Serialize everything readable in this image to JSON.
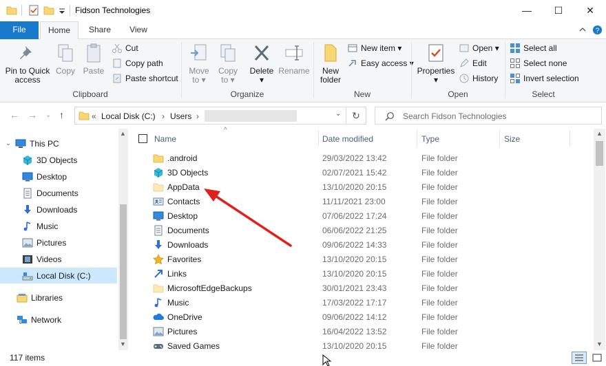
{
  "window": {
    "title": "Fidson Technologies",
    "minimize_glyph": "—",
    "maximize_glyph": "☐",
    "close_glyph": "✕"
  },
  "tabs": {
    "file": "File",
    "home": "Home",
    "share": "Share",
    "view": "View"
  },
  "ribbon": {
    "clipboard": {
      "label": "Clipboard",
      "pin_line1": "Pin to Quick",
      "pin_line2": "access",
      "copy": "Copy",
      "paste": "Paste",
      "cut": "Cut",
      "copy_path": "Copy path",
      "paste_shortcut": "Paste shortcut"
    },
    "organize": {
      "label": "Organize",
      "move_to_1": "Move",
      "move_to_2": "to",
      "copy_to_1": "Copy",
      "copy_to_2": "to",
      "delete": "Delete",
      "rename": "Rename"
    },
    "new": {
      "label": "New",
      "new_folder_1": "New",
      "new_folder_2": "folder",
      "new_item": "New item",
      "easy_access": "Easy access"
    },
    "open": {
      "label": "Open",
      "properties": "Properties",
      "open": "Open",
      "edit": "Edit",
      "history": "History"
    },
    "select": {
      "label": "Select",
      "select_all": "Select all",
      "select_none": "Select none",
      "invert_selection": "Invert selection"
    }
  },
  "address": {
    "prefix": "«",
    "crumb1": "Local Disk (C:)",
    "crumb2": "Users",
    "sep": "›"
  },
  "search": {
    "placeholder": "Search Fidson Technologies"
  },
  "nav": {
    "items": [
      {
        "label": "This PC",
        "icon": "this-pc-icon"
      },
      {
        "label": "3D Objects",
        "icon": "3d-objects-icon"
      },
      {
        "label": "Desktop",
        "icon": "desktop-icon"
      },
      {
        "label": "Documents",
        "icon": "documents-icon"
      },
      {
        "label": "Downloads",
        "icon": "downloads-icon"
      },
      {
        "label": "Music",
        "icon": "music-icon"
      },
      {
        "label": "Pictures",
        "icon": "pictures-icon"
      },
      {
        "label": "Videos",
        "icon": "videos-icon"
      },
      {
        "label": "Local Disk (C:)",
        "icon": "drive-icon"
      },
      {
        "label": "Libraries",
        "icon": "libraries-icon"
      },
      {
        "label": "Network",
        "icon": "network-icon"
      }
    ]
  },
  "columns": {
    "name": "Name",
    "date": "Date modified",
    "type": "Type",
    "size": "Size"
  },
  "files": [
    {
      "name": ".android",
      "date": "29/03/2022 13:42",
      "type": "File folder",
      "icon": "folder-icon"
    },
    {
      "name": "3D Objects",
      "date": "02/07/2021 15:42",
      "type": "File folder",
      "icon": "3d-objects-icon"
    },
    {
      "name": "AppData",
      "date": "13/10/2020 20:15",
      "type": "File folder",
      "icon": "folder-hidden-icon"
    },
    {
      "name": "Contacts",
      "date": "11/11/2021 23:00",
      "type": "File folder",
      "icon": "contacts-icon"
    },
    {
      "name": "Desktop",
      "date": "07/06/2022 17:24",
      "type": "File folder",
      "icon": "desktop-icon"
    },
    {
      "name": "Documents",
      "date": "06/06/2022 21:25",
      "type": "File folder",
      "icon": "documents-icon"
    },
    {
      "name": "Downloads",
      "date": "09/06/2022 14:33",
      "type": "File folder",
      "icon": "downloads-icon"
    },
    {
      "name": "Favorites",
      "date": "13/10/2020 20:15",
      "type": "File folder",
      "icon": "favorites-icon"
    },
    {
      "name": "Links",
      "date": "13/10/2020 20:15",
      "type": "File folder",
      "icon": "links-icon"
    },
    {
      "name": "MicrosoftEdgeBackups",
      "date": "30/01/2021 23:43",
      "type": "File folder",
      "icon": "folder-hidden-icon"
    },
    {
      "name": "Music",
      "date": "17/03/2022 17:17",
      "type": "File folder",
      "icon": "music-icon"
    },
    {
      "name": "OneDrive",
      "date": "09/06/2022 14:12",
      "type": "File folder",
      "icon": "onedrive-icon"
    },
    {
      "name": "Pictures",
      "date": "16/04/2022 13:52",
      "type": "File folder",
      "icon": "pictures-icon"
    },
    {
      "name": "Saved Games",
      "date": "13/10/2020 20:15",
      "type": "File folder",
      "icon": "saved-games-icon"
    }
  ],
  "status": {
    "count": "117 items"
  },
  "colors": {
    "accent": "#1979ca",
    "selection": "#cce8ff",
    "folder": "#f8d775",
    "annotation_arrow": "#e0201b"
  }
}
